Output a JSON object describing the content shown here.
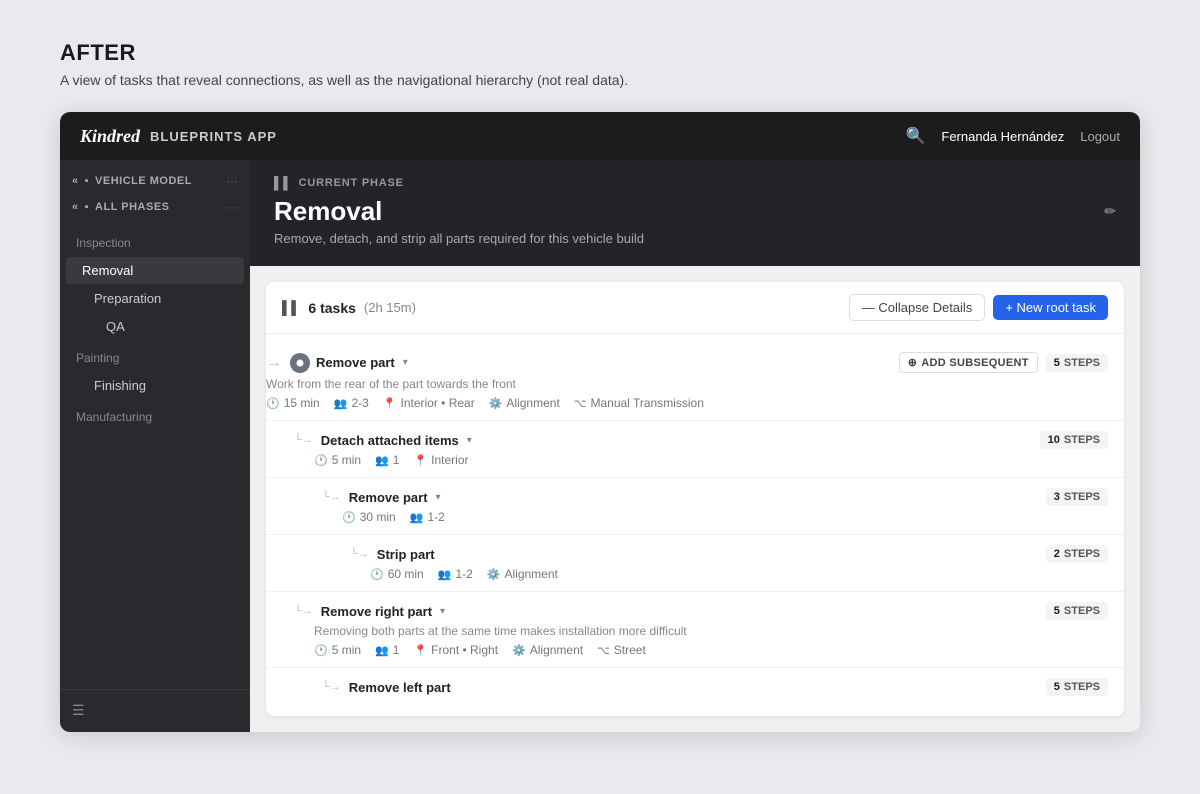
{
  "page": {
    "heading": "AFTER",
    "subheading": "A view of tasks that reveal connections, as well as the navigational hierarchy (not real data)."
  },
  "topnav": {
    "logo": "Kindred",
    "appname": "BLUEPRINTS APP",
    "searchIcon": "🔍",
    "user": "Fernanda Hernández",
    "logout": "Logout"
  },
  "sidebar": {
    "vehicleModel": "VEHICLE MODEL",
    "allPhases": "ALL PHASES",
    "sections": [
      {
        "label": "Inspection",
        "items": [
          {
            "name": "Removal",
            "active": true,
            "level": 1
          },
          {
            "name": "Preparation",
            "level": 1
          },
          {
            "name": "QA",
            "level": 2
          }
        ]
      },
      {
        "label": "Painting",
        "items": [
          {
            "name": "Finishing",
            "level": 2
          }
        ]
      },
      {
        "label": "Manufacturing",
        "items": []
      }
    ]
  },
  "phase": {
    "currentPhaseLabel": "CURRENT PHASE",
    "title": "Removal",
    "description": "Remove, detach, and strip all parts required for this vehicle build",
    "editIcon": "✏️"
  },
  "taskPanel": {
    "tasksCount": "6 tasks",
    "tasksTime": "(2h 15m)",
    "collapseLabel": "— Collapse Details",
    "newTaskLabel": "+ New root task"
  },
  "tasks": [
    {
      "id": "task-1",
      "level": 1,
      "name": "Remove part",
      "hasDropdown": true,
      "hasConnector": false,
      "description": "Work from the rear of the part towards the front",
      "addSubsequent": "ADD SUBSEQUENT",
      "stepsCount": "5",
      "stepsLabel": "STEPS",
      "meta": [
        {
          "icon": "🕐",
          "text": "15 min"
        },
        {
          "icon": "👥",
          "text": "2-3"
        },
        {
          "icon": "📍",
          "text": "Interior • Rear"
        },
        {
          "icon": "⚙️",
          "text": "Alignment"
        },
        {
          "icon": "🔧",
          "text": "Manual Transmission"
        }
      ]
    },
    {
      "id": "task-2",
      "level": 2,
      "name": "Detach attached items",
      "hasDropdown": true,
      "hasConnector": true,
      "description": "",
      "stepsCount": "10",
      "stepsLabel": "STEPS",
      "meta": [
        {
          "icon": "🕐",
          "text": "5 min"
        },
        {
          "icon": "👥",
          "text": "1"
        },
        {
          "icon": "📍",
          "text": "Interior"
        }
      ]
    },
    {
      "id": "task-3",
      "level": 3,
      "name": "Remove part",
      "hasDropdown": true,
      "hasConnector": true,
      "description": "",
      "stepsCount": "3",
      "stepsLabel": "STEPS",
      "meta": [
        {
          "icon": "🕐",
          "text": "30 min"
        },
        {
          "icon": "👥",
          "text": "1-2"
        }
      ]
    },
    {
      "id": "task-4",
      "level": 4,
      "name": "Strip part",
      "hasDropdown": false,
      "hasConnector": true,
      "description": "",
      "stepsCount": "2",
      "stepsLabel": "STEPS",
      "meta": [
        {
          "icon": "🕐",
          "text": "60 min"
        },
        {
          "icon": "👥",
          "text": "1-2"
        },
        {
          "icon": "⚙️",
          "text": "Alignment"
        }
      ]
    },
    {
      "id": "task-5",
      "level": 2,
      "name": "Remove right part",
      "hasDropdown": true,
      "hasConnector": true,
      "description": "Removing both parts at the same time makes installation more difficult",
      "stepsCount": "5",
      "stepsLabel": "STEPS",
      "meta": [
        {
          "icon": "🕐",
          "text": "5 min"
        },
        {
          "icon": "👥",
          "text": "1"
        },
        {
          "icon": "📍",
          "text": "Front • Right"
        },
        {
          "icon": "⚙️",
          "text": "Alignment"
        },
        {
          "icon": "🔧",
          "text": "Street"
        }
      ]
    },
    {
      "id": "task-6",
      "level": 3,
      "name": "Remove left part",
      "hasDropdown": false,
      "hasConnector": true,
      "description": "",
      "stepsCount": "5",
      "stepsLabel": "STEPS",
      "meta": []
    }
  ]
}
